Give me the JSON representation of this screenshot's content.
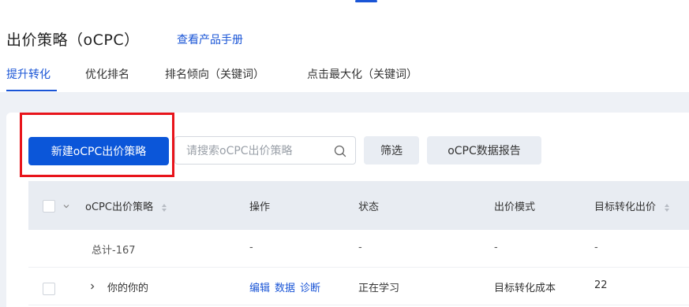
{
  "header": {
    "title": "出价策略（oCPC）",
    "manual_link": "查看产品手册"
  },
  "tabs": [
    {
      "label": "提升转化",
      "active": true
    },
    {
      "label": "优化排名",
      "active": false
    },
    {
      "label": "排名倾向（关键词）",
      "active": false
    },
    {
      "label": "点击最大化（关键词）",
      "active": false
    }
  ],
  "toolbar": {
    "new_button": "新建oCPC出价策略",
    "search_placeholder": "请搜索oCPC出价策略",
    "filter_button": "筛选",
    "report_button": "oCPC数据报告"
  },
  "table": {
    "columns": [
      "oCPC出价策略",
      "操作",
      "状态",
      "出价模式",
      "目标转化出价"
    ],
    "total_row": {
      "name": "总计-167",
      "action": "-",
      "status": "-",
      "mode": "-",
      "bid": "-"
    },
    "rows": [
      {
        "name": "你的你的",
        "actions": [
          "编辑",
          "数据",
          "诊断"
        ],
        "status": "正在学习",
        "mode": "目标转化成本",
        "bid": "22"
      }
    ]
  },
  "colors": {
    "primary": "#0b56d9",
    "link": "#1a55d6",
    "highlight": "#e8141b"
  }
}
